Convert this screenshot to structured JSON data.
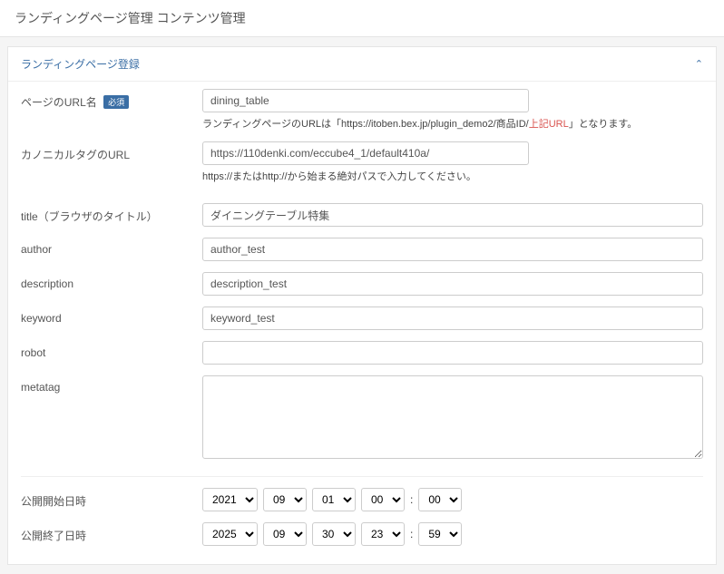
{
  "page_title": "ランディングページ管理  コンテンツ管理",
  "panel_title": "ランディングページ登録",
  "labels": {
    "url_name": "ページのURL名",
    "required": "必須",
    "canonical": "カノニカルタグのURL",
    "title": "title（ブラウザのタイトル）",
    "author": "author",
    "description": "description",
    "keyword": "keyword",
    "robot": "robot",
    "metatag": "metatag",
    "start": "公開開始日時",
    "end": "公開終了日時"
  },
  "values": {
    "url_name": "dining_table",
    "canonical": "https://110denki.com/eccube4_1/default410a/",
    "title": "ダイニングテーブル特集",
    "author": "author_test",
    "description": "description_test",
    "keyword": "keyword_test",
    "robot": "",
    "metatag": ""
  },
  "help": {
    "url_prefix": "ランディングページのURLは「https://itoben.bex.jp/plugin_demo2/商品ID/",
    "url_mid": "上記URL",
    "url_suffix": "」となります。",
    "canonical": "https://またはhttp://から始まる絶対パスで入力してください。"
  },
  "dates": {
    "start": {
      "year": "2021",
      "month": "09",
      "day": "01",
      "hour": "00",
      "min": "00"
    },
    "end": {
      "year": "2025",
      "month": "09",
      "day": "30",
      "hour": "23",
      "min": "59"
    }
  }
}
